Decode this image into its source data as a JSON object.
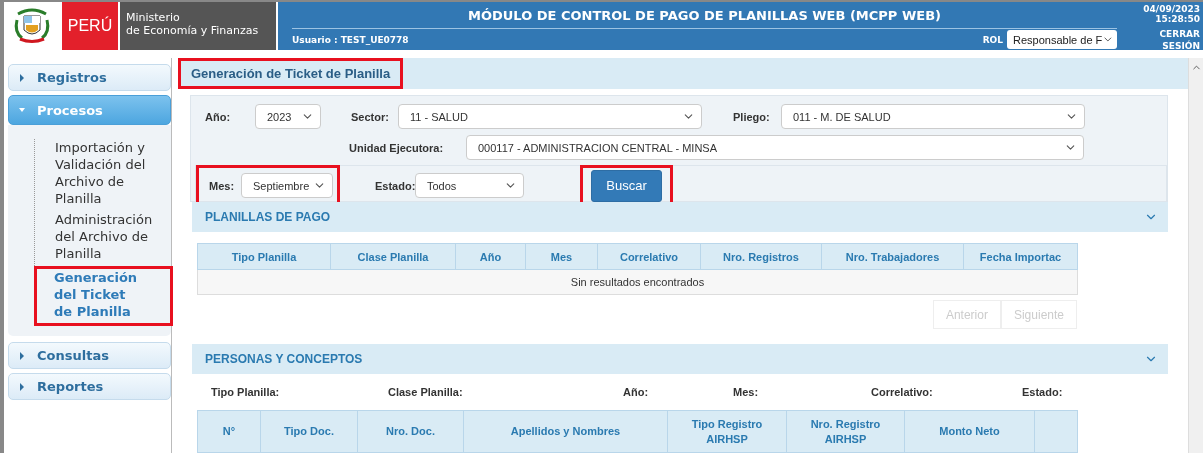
{
  "header": {
    "country": "PERÚ",
    "ministry_line_1": "Ministerio",
    "ministry_line_2": "de Economía y Finanzas",
    "title": "MÓDULO DE CONTROL DE PAGO DE PLANILLAS WEB (MCPP WEB)",
    "user": "Usuario : TEST_UE0778",
    "role_label": "ROL",
    "role_value": "Responsable de F",
    "date": "04/09/2023",
    "time": "15:28:50",
    "logout": "CERRAR SESIÓN"
  },
  "sidebar": {
    "items": [
      {
        "label": "Registros",
        "expanded": false
      },
      {
        "label": "Procesos",
        "expanded": true,
        "children": [
          {
            "label": "Importación y Validación del Archivo de Planilla",
            "selected": false,
            "highlighted": false
          },
          {
            "label": "Administración del Archivo de Planilla",
            "selected": false,
            "highlighted": false
          },
          {
            "label": "Generación del Ticket de Planilla",
            "selected": true,
            "highlighted": true
          }
        ]
      },
      {
        "label": "Consultas",
        "expanded": false
      },
      {
        "label": "Reportes",
        "expanded": false
      }
    ]
  },
  "page_title": {
    "text": "Generación de Ticket de Planilla",
    "highlighted": true
  },
  "filters": {
    "year": {
      "label": "Año:",
      "value": "2023"
    },
    "sector": {
      "label": "Sector:",
      "value": "11 - SALUD"
    },
    "pliego": {
      "label": "Pliego:",
      "value": "011 - M. DE SALUD"
    },
    "unit": {
      "label": "Unidad Ejecutora:",
      "value": "000117 - ADMINISTRACION CENTRAL - MINSA"
    },
    "month": {
      "label": "Mes:",
      "value": "Septiembre",
      "highlighted": true
    },
    "status": {
      "label": "Estado:",
      "value": "Todos"
    },
    "search_button": {
      "label": "Buscar",
      "highlighted": true
    }
  },
  "planillas": {
    "title": "PLANILLAS DE PAGO",
    "expanded": true,
    "columns": [
      "Tipo Planilla",
      "Clase Planilla",
      "Año",
      "Mes",
      "Correlativo",
      "Nro. Registros",
      "Nro. Trabajadores",
      "Fecha Importac"
    ],
    "empty_message": "Sin resultados encontrados",
    "pager": [
      {
        "label": "Anterior",
        "disabled": true
      },
      {
        "label": "Siguiente",
        "disabled": true
      }
    ]
  },
  "personas": {
    "title": "PERSONAS Y CONCEPTOS",
    "expanded": true,
    "info_labels": [
      "Tipo Planilla:",
      "Clase Planilla:",
      "Año:",
      "Mes:",
      "Correlativo:",
      "Estado:"
    ],
    "columns": [
      "N°",
      "Tipo Doc.",
      "Nro. Doc.",
      "Apellidos y Nombres",
      "Tipo Registro AIRHSP",
      "Nro. Registro AIRHSP",
      "Monto Neto"
    ]
  }
}
